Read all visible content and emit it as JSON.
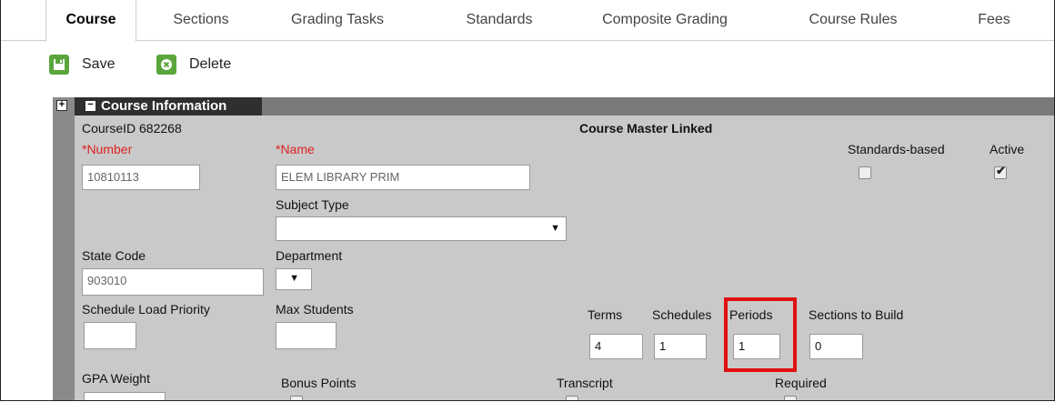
{
  "tabs": [
    {
      "label": "Course",
      "active": true
    },
    {
      "label": "Sections",
      "active": false
    },
    {
      "label": "Grading Tasks",
      "active": false
    },
    {
      "label": "Standards",
      "active": false
    },
    {
      "label": "Composite Grading",
      "active": false
    },
    {
      "label": "Course Rules",
      "active": false
    },
    {
      "label": "Fees",
      "active": false
    }
  ],
  "toolbar": {
    "save_label": "Save",
    "delete_label": "Delete",
    "accent": "#5aa63c"
  },
  "section": {
    "title": "Course Information",
    "expand_symbol": "+",
    "collapse_symbol": "−"
  },
  "course": {
    "course_id": "CourseID 682268",
    "master_linked": "Course Master Linked",
    "number_label": "*Number",
    "number_value": "10810113",
    "name_label": "*Name",
    "name_value": "ELEM LIBRARY PRIM",
    "standards_label": "Standards-based",
    "standards_checked": false,
    "active_label": "Active",
    "active_checked": true,
    "subject_type_label": "Subject Type",
    "subject_type_value": "",
    "state_code_label": "State Code",
    "state_code_value": "903010",
    "department_label": "Department",
    "department_value": "",
    "schedule_priority_label": "Schedule Load Priority",
    "schedule_priority_value": "",
    "max_students_label": "Max Students",
    "max_students_value": "",
    "terms_label": "Terms",
    "terms_value": "4",
    "schedules_label": "Schedules",
    "schedules_value": "1",
    "periods_label": "Periods",
    "periods_value": "1",
    "sections_build_label": "Sections to Build",
    "sections_build_value": "0",
    "gpa_weight_label": "GPA Weight",
    "bonus_points_label": "Bonus Points",
    "transcript_label": "Transcript",
    "required_label": "Required"
  },
  "colors": {
    "required": "#e02020",
    "highlight": "#e01010",
    "panel": "#c9c9c9",
    "header": "#2f2f2f"
  }
}
